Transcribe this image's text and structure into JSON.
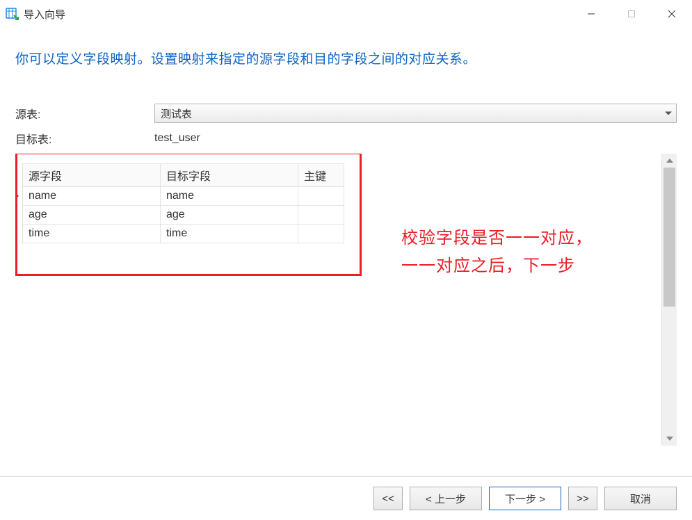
{
  "window": {
    "title": "导入向导"
  },
  "description": "你可以定义字段映射。设置映射来指定的源字段和目的字段之间的对应关系。",
  "form": {
    "source_table_label": "源表:",
    "source_table_value": "测试表",
    "target_table_label": "目标表:",
    "target_table_value": "test_user"
  },
  "table": {
    "headers": {
      "source_field": "源字段",
      "target_field": "目标字段",
      "primary_key": "主键"
    },
    "rows": [
      {
        "src": "name",
        "dst": "name",
        "pk": ""
      },
      {
        "src": "age",
        "dst": "age",
        "pk": ""
      },
      {
        "src": "time",
        "dst": "time",
        "pk": ""
      }
    ]
  },
  "annotation": {
    "line1": "校验字段是否一一对应，",
    "line2": "一一对应之后，下一步"
  },
  "footer": {
    "first": "<<",
    "prev": "< 上一步",
    "next": "下一步 >",
    "last": ">>",
    "cancel": "取消"
  }
}
